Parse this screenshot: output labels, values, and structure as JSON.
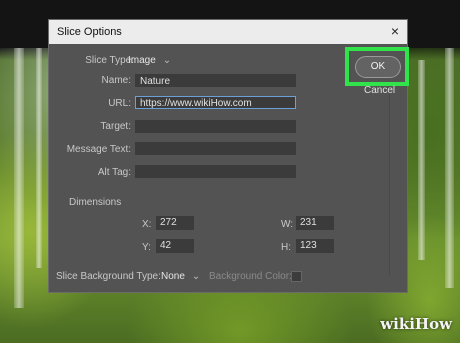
{
  "dialog": {
    "title": "Slice Options",
    "close_glyph": "×"
  },
  "slice_type": {
    "label": "Slice Type:",
    "value": "Image"
  },
  "fields": {
    "name": {
      "label": "Name:",
      "value": "Nature"
    },
    "url": {
      "label": "URL:",
      "value": "https://www.wikiHow.com"
    },
    "target": {
      "label": "Target:",
      "value": ""
    },
    "message_text": {
      "label": "Message Text:",
      "value": ""
    },
    "alt_tag": {
      "label": "Alt Tag:",
      "value": ""
    }
  },
  "dimensions": {
    "heading": "Dimensions",
    "x": {
      "label": "X:",
      "value": "272"
    },
    "y": {
      "label": "Y:",
      "value": "42"
    },
    "w": {
      "label": "W:",
      "value": "231"
    },
    "h": {
      "label": "H:",
      "value": "123"
    }
  },
  "background": {
    "type_label": "Slice Background Type:",
    "type_value": "None",
    "color_label": "Background Color:"
  },
  "buttons": {
    "ok": "OK",
    "cancel": "Cancel"
  },
  "colors": {
    "highlight": "#34e34c",
    "dialog_bg": "#535353"
  },
  "watermark": "wikiHow"
}
